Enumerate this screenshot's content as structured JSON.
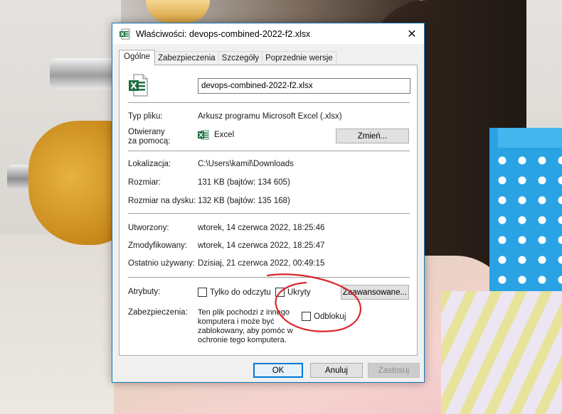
{
  "window": {
    "title": "Właściwości: devops-combined-2022-f2.xlsx",
    "close_glyph": "✕"
  },
  "tabs": [
    {
      "label": "Ogólne",
      "active": true
    },
    {
      "label": "Zabezpieczenia",
      "active": false
    },
    {
      "label": "Szczegóły",
      "active": false
    },
    {
      "label": "Poprzednie wersje",
      "active": false
    }
  ],
  "general": {
    "file_name": "devops-combined-2022-f2.xlsx",
    "file_type_label": "Typ pliku:",
    "file_type_value": "Arkusz programu Microsoft Excel (.xlsx)",
    "opens_with_label_line1": "Otwierany",
    "opens_with_label_line2": "za pomocą:",
    "opens_with_value": "Excel",
    "change_button": "Zmień...",
    "location_label": "Lokalizacja:",
    "location_value": "C:\\Users\\kamil\\Downloads",
    "size_label": "Rozmiar:",
    "size_value": "131 KB (bajtów: 134 605)",
    "size_on_disk_label": "Rozmiar na dysku:",
    "size_on_disk_value": "132 KB (bajtów: 135 168)",
    "created_label": "Utworzony:",
    "created_value": "wtorek, 14 czerwca 2022, 18:25:46",
    "modified_label": "Zmodyfikowany:",
    "modified_value": "wtorek, 14 czerwca 2022, 18:25:47",
    "accessed_label": "Ostatnio używany:",
    "accessed_value": "Dzisiaj, 21 czerwca 2022, 00:49:15",
    "attributes_label": "Atrybuty:",
    "readonly_label": "Tylko do odczytu",
    "hidden_label": "Ukryty",
    "advanced_button": "Zaawansowane...",
    "security_label": "Zabezpieczenia:",
    "security_text": "Ten plik pochodzi z innego komputera i może być zablokowany, aby pomóc w ochronie tego komputera.",
    "unblock_label": "Odblokuj"
  },
  "footer": {
    "ok": "OK",
    "cancel": "Anuluj",
    "apply": "Zastosuj"
  },
  "colors": {
    "excel_green": "#1d6f42",
    "accent_blue": "#0078d7",
    "annotation_red": "#d8262b"
  },
  "icons": {
    "title": "excel-file-icon",
    "file": "excel-file-icon",
    "app": "excel-app-icon",
    "close": "close-icon"
  }
}
